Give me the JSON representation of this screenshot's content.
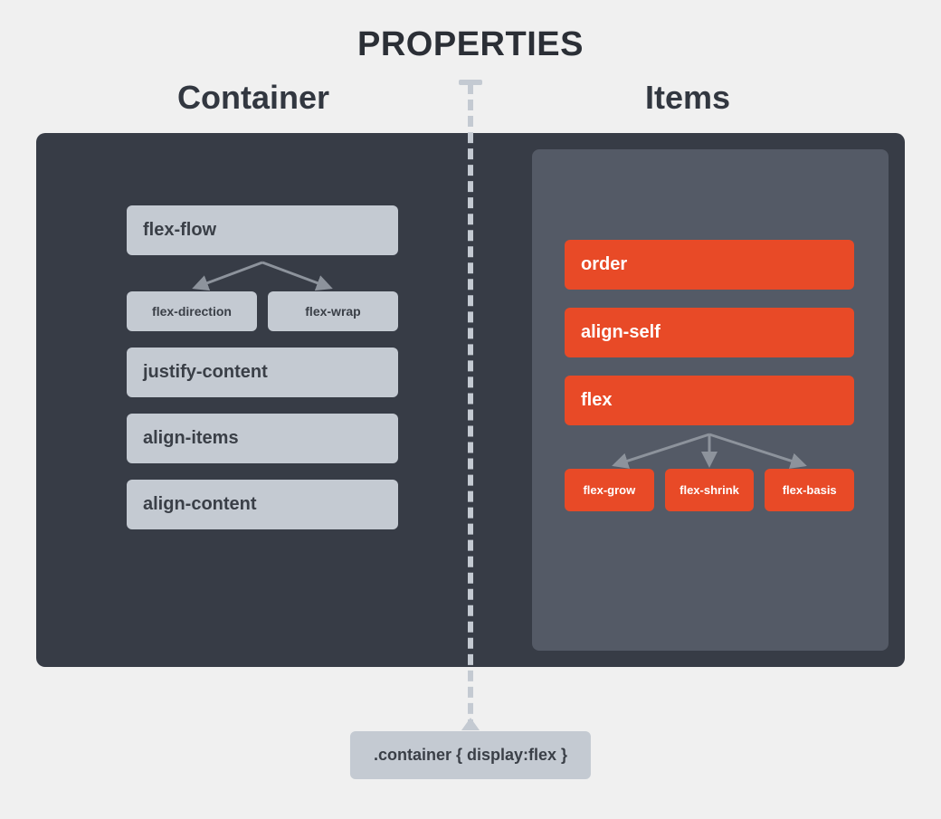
{
  "title": "PROPERTIES",
  "columns": {
    "left_header": "Container",
    "right_header": "Items"
  },
  "container_props": {
    "flex_flow": "flex-flow",
    "flex_direction": "flex-direction",
    "flex_wrap": "flex-wrap",
    "justify_content": "justify-content",
    "align_items": "align-items",
    "align_content": "align-content"
  },
  "item_props": {
    "order": "order",
    "align_self": "align-self",
    "flex": "flex",
    "flex_grow": "flex-grow",
    "flex_shrink": "flex-shrink",
    "flex_basis": "flex-basis"
  },
  "footer_code": ".container { display:flex }"
}
